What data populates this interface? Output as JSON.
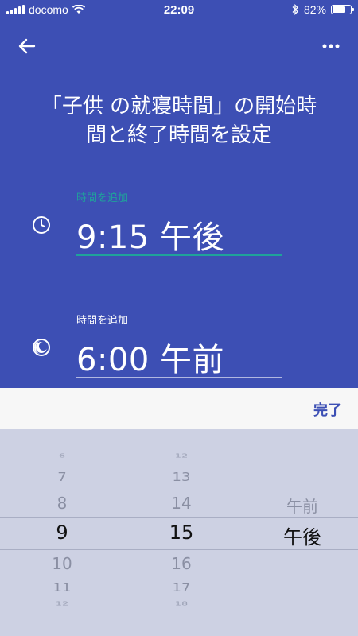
{
  "status": {
    "carrier": "docomo",
    "time": "22:09",
    "battery_text": "82%",
    "battery_level": 0.82
  },
  "header": {
    "back_icon": "arrow-left-icon",
    "more_icon": "more-horizontal-icon"
  },
  "title": {
    "line1": "「子供 の就寝時間」の開始時",
    "line2": "間と終了時間を設定"
  },
  "start": {
    "label": "時間を追加",
    "value": "9:15 午後",
    "icon": "clock-icon"
  },
  "end": {
    "label": "時間を追加",
    "value": "6:00 午前",
    "icon": "moon-icon"
  },
  "done_label": "完了",
  "picker": {
    "hours": [
      "6",
      "7",
      "8",
      "9",
      "10",
      "11",
      "12"
    ],
    "minutes": [
      "12",
      "13",
      "14",
      "15",
      "16",
      "17",
      "18"
    ],
    "periods": [
      "午前",
      "午後"
    ]
  },
  "colors": {
    "background": "#3d4fb4",
    "accent": "#1fa39a",
    "done": "#3c4fb4"
  }
}
